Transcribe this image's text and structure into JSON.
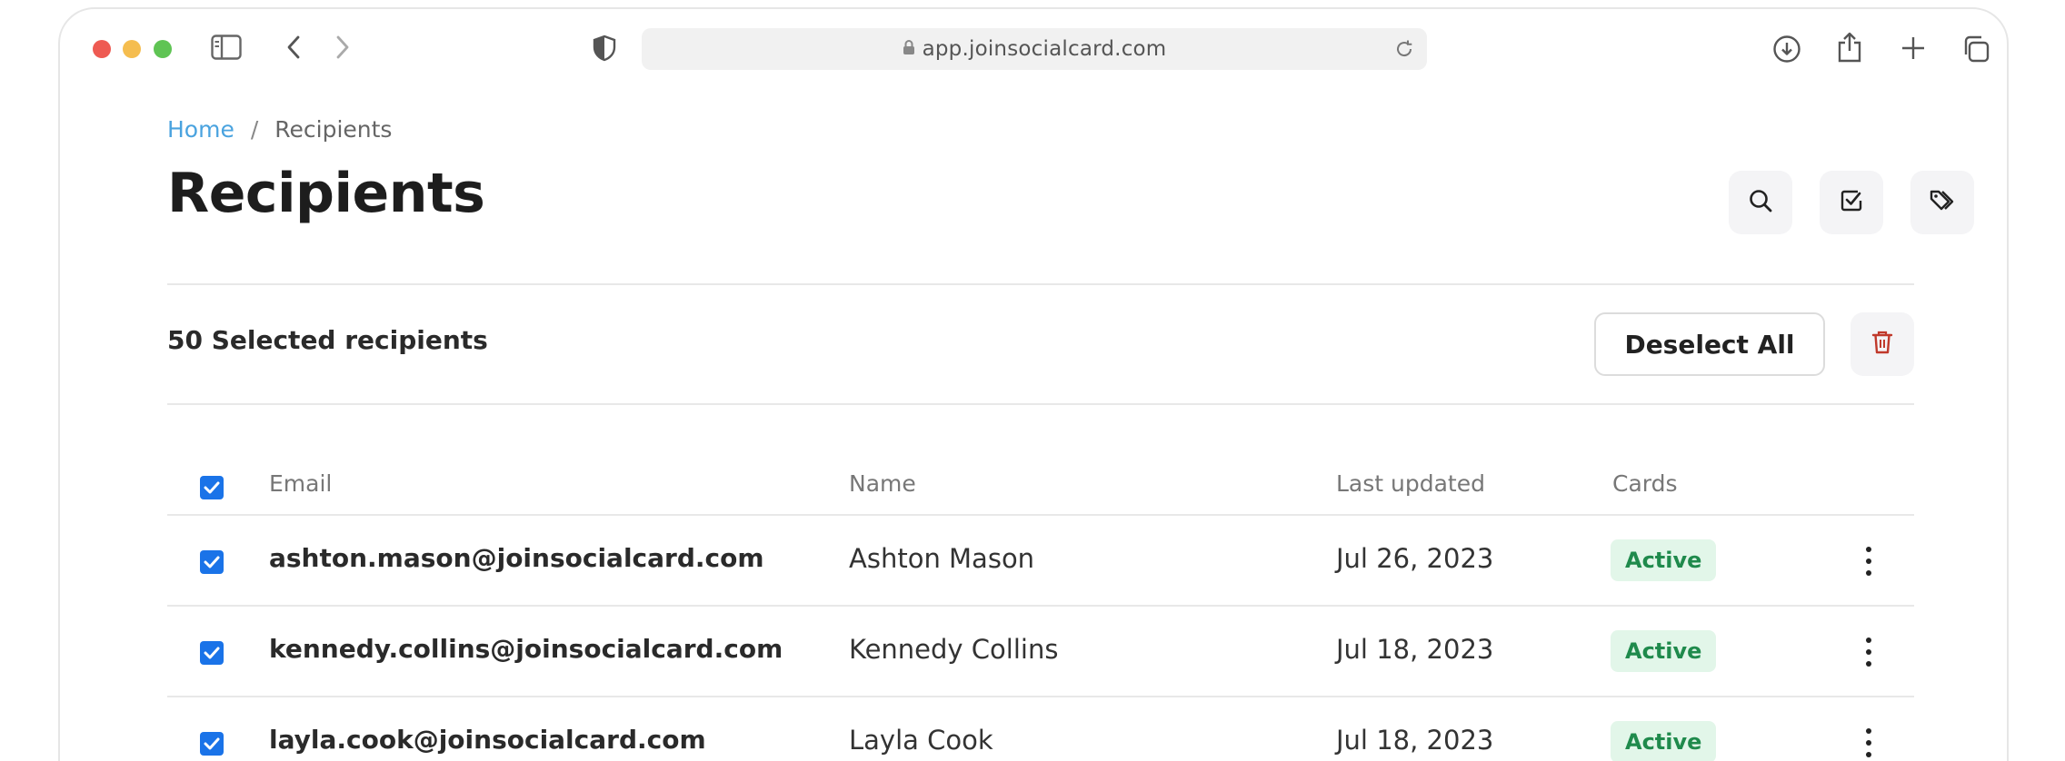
{
  "browser": {
    "url": "app.joinsocialcard.com"
  },
  "breadcrumb": {
    "home": "Home",
    "separator": "/",
    "current": "Recipients"
  },
  "page": {
    "title": "Recipients"
  },
  "selection": {
    "label": "50 Selected recipients",
    "deselect_label": "Deselect All"
  },
  "table": {
    "columns": {
      "email": "Email",
      "name": "Name",
      "last_updated": "Last updated",
      "cards": "Cards"
    },
    "rows": [
      {
        "email": "ashton.mason@joinsocialcard.com",
        "name": "Ashton Mason",
        "last_updated": "Jul 26, 2023",
        "cards": "Active",
        "selected": true
      },
      {
        "email": "kennedy.collins@joinsocialcard.com",
        "name": "Kennedy Collins",
        "last_updated": "Jul 18, 2023",
        "cards": "Active",
        "selected": true
      },
      {
        "email": "layla.cook@joinsocialcard.com",
        "name": "Layla Cook",
        "last_updated": "Jul 18, 2023",
        "cards": "Active",
        "selected": true
      }
    ]
  },
  "colors": {
    "link": "#4aa3df",
    "checkbox": "#1a73e8",
    "badge_bg": "#e2f6e9",
    "badge_text": "#1f8a4c",
    "danger": "#c0392b"
  }
}
